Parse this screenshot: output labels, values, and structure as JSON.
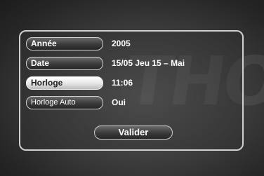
{
  "settings": {
    "rows": [
      {
        "label": "Année",
        "value": "2005"
      },
      {
        "label": "Date",
        "value": "15/05  Jeu   15 – Mai"
      },
      {
        "label": "Horloge",
        "value": "11:06"
      },
      {
        "label": "Horloge Auto",
        "value": "Oui"
      }
    ],
    "selected_row": "Horloge",
    "validate_label": "Valider"
  }
}
